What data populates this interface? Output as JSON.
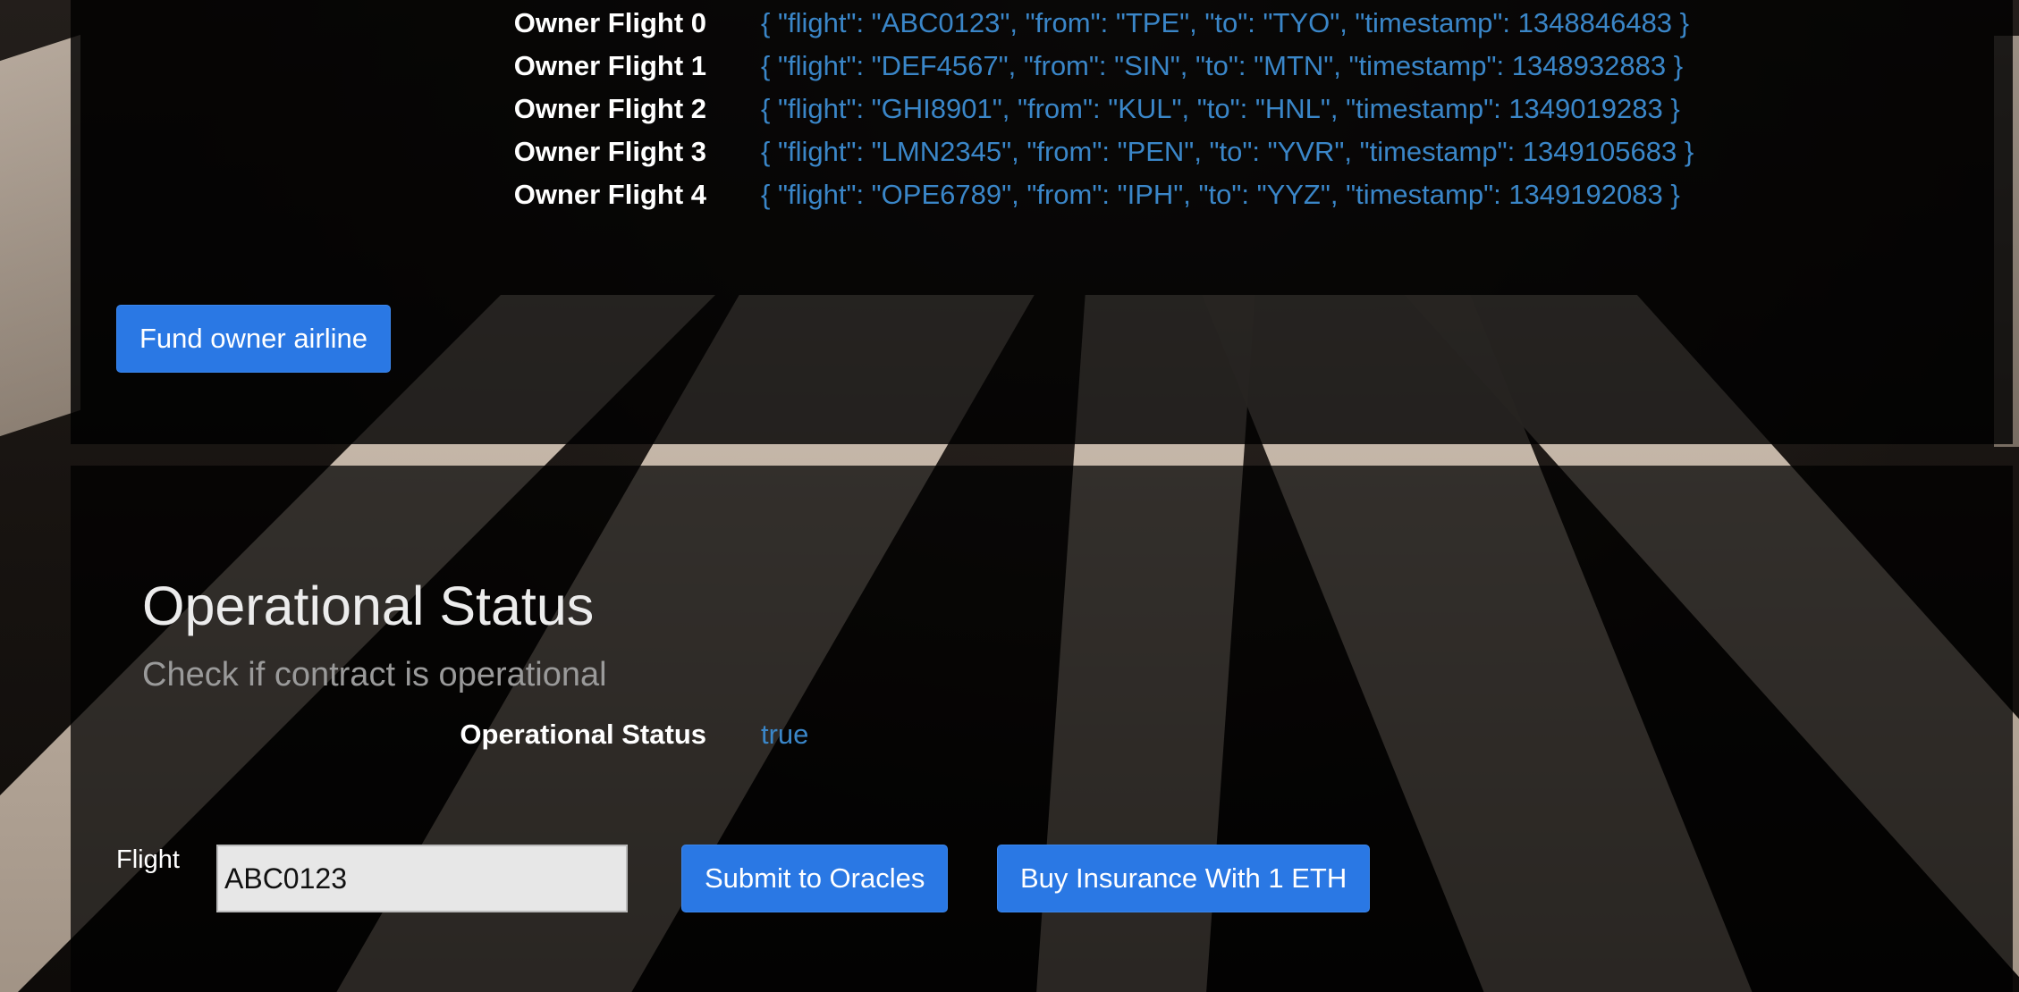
{
  "owner_flights": [
    {
      "label": "Owner Flight 0",
      "value": "{ \"flight\": \"ABC0123\", \"from\": \"TPE\", \"to\": \"TYO\", \"timestamp\": 1348846483 }"
    },
    {
      "label": "Owner Flight 1",
      "value": "{ \"flight\": \"DEF4567\", \"from\": \"SIN\", \"to\": \"MTN\", \"timestamp\": 1348932883 }"
    },
    {
      "label": "Owner Flight 2",
      "value": "{ \"flight\": \"GHI8901\", \"from\": \"KUL\", \"to\": \"HNL\", \"timestamp\": 1349019283 }"
    },
    {
      "label": "Owner Flight 3",
      "value": "{ \"flight\": \"LMN2345\", \"from\": \"PEN\", \"to\": \"YVR\", \"timestamp\": 1349105683 }"
    },
    {
      "label": "Owner Flight 4",
      "value": "{ \"flight\": \"OPE6789\", \"from\": \"IPH\", \"to\": \"YYZ\", \"timestamp\": 1349192083 }"
    }
  ],
  "fund_button_label": "Fund owner airline",
  "operational": {
    "title": "Operational Status",
    "subtitle": "Check if contract is operational",
    "status_label": "Operational Status",
    "status_value": "true"
  },
  "flight_form": {
    "label": "Flight",
    "input_value": "ABC0123",
    "submit_label": "Submit to Oracles",
    "buy_label": "Buy Insurance With 1 ETH"
  },
  "colors": {
    "button": "#2a78e4",
    "value_text": "#3a86c8"
  }
}
